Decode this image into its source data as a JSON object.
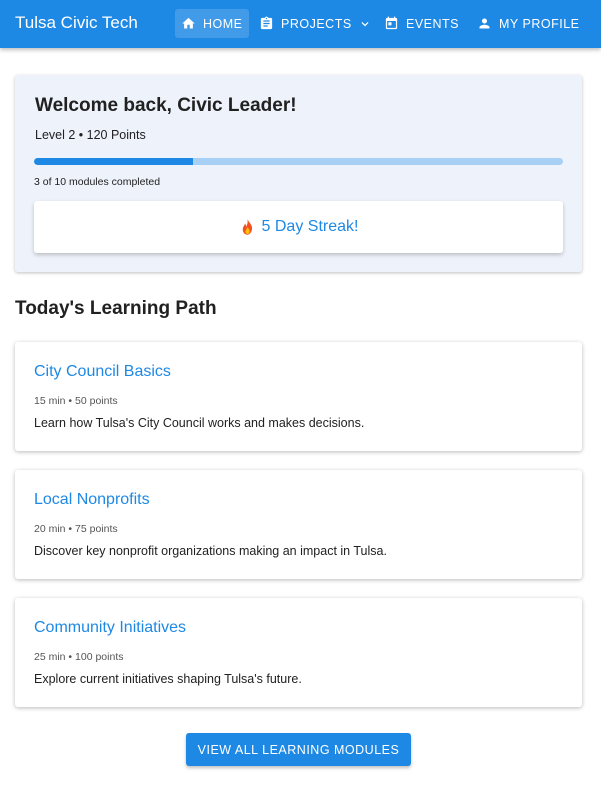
{
  "app": {
    "brand": "Tulsa Civic Tech",
    "primary_color": "#1e88e5"
  },
  "nav": {
    "items": [
      {
        "label": "HOME",
        "icon": "home-icon",
        "active": true
      },
      {
        "label": "PROJECTS",
        "icon": "clipboard-icon",
        "dropdown": true
      },
      {
        "label": "EVENTS",
        "icon": "calendar-icon"
      },
      {
        "label": "MY PROFILE",
        "icon": "person-icon"
      }
    ]
  },
  "welcome": {
    "title": "Welcome back, Civic Leader!",
    "level": "Level 2 • 120 Points",
    "progress_fraction": 0.3,
    "modules_completed": "3 of 10 modules completed",
    "streak_icon": "fire-icon",
    "streak": "5 Day Streak!"
  },
  "learning_path": {
    "title": "Today's Learning Path",
    "modules": [
      {
        "title": "City Council Basics",
        "meta": "15 min • 50 points",
        "description": "Learn how Tulsa's City Council works and makes decisions."
      },
      {
        "title": "Local Nonprofits",
        "meta": "20 min • 75 points",
        "description": "Discover key nonprofit organizations making an impact in Tulsa."
      },
      {
        "title": "Community Initiatives",
        "meta": "25 min • 100 points",
        "description": "Explore current initiatives shaping Tulsa's future."
      }
    ]
  },
  "actions": {
    "view_all": "VIEW ALL LEARNING MODULES"
  }
}
